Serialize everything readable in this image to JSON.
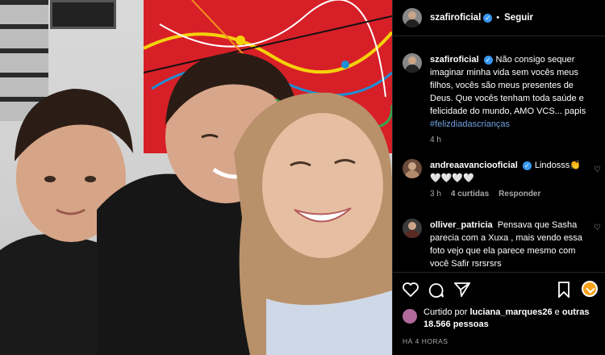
{
  "post": {
    "author": "szafiroficial",
    "follow_label": "Seguir",
    "separator": "•"
  },
  "caption": {
    "author": "szafiroficial",
    "text": "Não consigo sequer imaginar minha vida sem vocês meus filhos, vocês são meus presentes de Deus. Que vocês tenham toda saúde e felicidade do mundo, AMO VCS... papis ",
    "hashtag": "#felizdiadascrianças",
    "time": "4 h"
  },
  "comments": [
    {
      "author": "andreaavanciooficial",
      "text": "Lindosss👏 🤍🤍🤍🤍",
      "time": "3 h",
      "likes": "4 curtidas",
      "reply": "Responder"
    },
    {
      "author": "olliver_patricia",
      "text": "Pensava que Sasha parecia com a Xuxa , mais vendo essa foto vejo que ela parece mesmo com você Safir rsrsrsrs"
    }
  ],
  "likes": {
    "prefix": "Curtido por",
    "user": "luciana_marques26",
    "conj": "e",
    "others": "outras 18.566 pessoas"
  },
  "time_ago": "HÁ 4 HORAS",
  "icons": {
    "like": "heart-icon",
    "comment": "comment-icon",
    "share": "paper-plane-icon",
    "save": "bookmark-icon"
  },
  "colors": {
    "background": "#000000",
    "link": "#6fa3e0",
    "verified": "#3897f0",
    "muted": "#a8a8a8"
  }
}
